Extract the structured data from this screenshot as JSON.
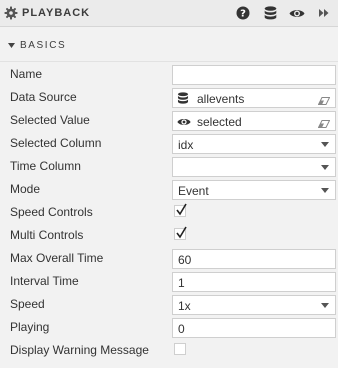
{
  "header": {
    "title": "PLAYBACK",
    "icons": [
      "gear-icon",
      "help-icon",
      "database-icon",
      "eye-icon",
      "fast-forward-icon"
    ]
  },
  "section": {
    "title": "BASICS",
    "expanded": true
  },
  "properties": {
    "name": {
      "label": "Name",
      "value": ""
    },
    "data_source": {
      "label": "Data Source",
      "value": "allevents",
      "icon": "database-icon"
    },
    "selected_value": {
      "label": "Selected Value",
      "value": "selected",
      "icon": "eye-icon"
    },
    "selected_column": {
      "label": "Selected Column",
      "value": "idx"
    },
    "time_column": {
      "label": "Time Column",
      "value": ""
    },
    "mode": {
      "label": "Mode",
      "value": "Event"
    },
    "speed_controls": {
      "label": "Speed Controls",
      "checked": true
    },
    "multi_controls": {
      "label": "Multi Controls",
      "checked": true
    },
    "max_overall_time": {
      "label": "Max Overall Time",
      "value": "60"
    },
    "interval_time": {
      "label": "Interval Time",
      "value": "1"
    },
    "speed": {
      "label": "Speed",
      "value": "1x"
    },
    "playing": {
      "label": "Playing",
      "value": "0"
    },
    "display_warning_message": {
      "label": "Display Warning Message",
      "checked": false
    }
  }
}
